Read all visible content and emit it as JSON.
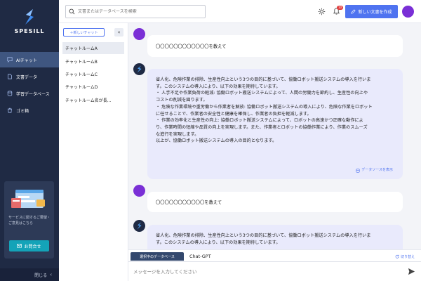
{
  "app": {
    "name": "SPESILL"
  },
  "sidebar": {
    "items": [
      {
        "label": "AIチャット",
        "active": true,
        "icon": "chat-icon"
      },
      {
        "label": "文書データ",
        "active": false,
        "icon": "document-icon"
      },
      {
        "label": "学習データベース",
        "active": false,
        "icon": "database-icon"
      },
      {
        "label": "ゴミ箱",
        "active": false,
        "icon": "trash-icon"
      }
    ],
    "promo": {
      "text": "サービスに関するご要望・ご意見はこちら",
      "button_label": "お問合せ"
    },
    "collapse_label": "閉じる"
  },
  "header": {
    "search_placeholder": "文書またはデータベースを検索",
    "notification_count": "10",
    "new_doc_label": "新しい文書を作成"
  },
  "chatlist": {
    "new_chat_label": "＋新しいチャット",
    "rooms": [
      {
        "label": "チャットルームA",
        "active": true
      },
      {
        "label": "チャットルームB",
        "active": false
      },
      {
        "label": "チャットルームC",
        "active": false
      },
      {
        "label": "チャットルームD",
        "active": false
      },
      {
        "label": "チャットルーム名が長...",
        "active": false
      }
    ]
  },
  "conversation": {
    "messages": [
      {
        "role": "user",
        "text": "〇〇〇〇〇〇〇〇〇〇〇〇を教えて"
      },
      {
        "role": "assistant",
        "lines": [
          "省人化、危険作業の排除、生産性向上という3つの目的に基づいて、協働ロボット搬送システムの導入を行いま",
          "す。このシステムの導入により、以下の効果を期待しています。",
          "・ 人手不足や作業負荷の軽減: 協働ロボット搬送システムによって、人間の労働力を節約し、生産性の向上や",
          "コストの削減を図ります。",
          "・ 危険な作業環境や重労働から作業者を解放: 協働ロボット搬送システムの導入により、危険な作業をロボット",
          "に任せることで、作業者の安全性と健康を確保し、作業者の負担を軽減します。",
          "・ 作業の効率化と生産性の向上: 協働ロボット搬送システムによって、ロボットの高速かつ正確な動作によ",
          "り、作業時間の短縮や品質の向上を実現します。また、作業者とロボットの協働作業により、作業のスムーズ",
          "な進行を実現します。",
          "以上が、協働ロボット搬送システムの導入の目的となります。"
        ],
        "source_label": "データソースを表示"
      },
      {
        "role": "user",
        "text": "〇〇〇〇〇〇〇〇〇〇〇を教えて"
      },
      {
        "role": "assistant",
        "lines": [
          "省人化、危険作業の排除、生産性向上という3つの目的に基づいて、協働ロボット搬送システムの導入を行いま",
          "す。このシステムの導入により、以下の効果を期待しています。"
        ]
      }
    ]
  },
  "database_bar": {
    "label": "選択中のデータベース",
    "value": "Chat-GPT",
    "switch_label": "切り替え"
  },
  "input": {
    "placeholder": "メッセージを入力してください"
  },
  "colors": {
    "sidebar_bg": "#1f2a44",
    "accent": "#4f73f0",
    "avatar": "#7a2fd6",
    "teal": "#14a3b8"
  }
}
